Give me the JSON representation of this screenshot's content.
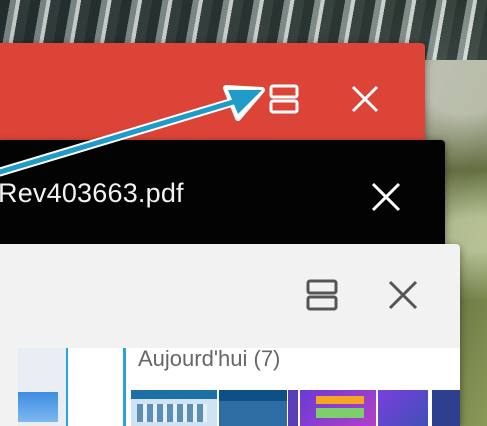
{
  "recents": {
    "cards": [
      {
        "id": "red",
        "color": "#dc4437",
        "icons": [
          "split-screen-icon",
          "close-icon"
        ]
      },
      {
        "id": "black",
        "color": "#030303",
        "title": "Rev403663.pdf",
        "icons": [
          "close-icon"
        ]
      },
      {
        "id": "white",
        "color": "#f2f2f2",
        "icons": [
          "split-screen-icon",
          "close-icon"
        ],
        "preview": {
          "section_title": "Aujourd'hui (7)"
        }
      }
    ]
  },
  "annotation": {
    "arrow_color": "#1e9bc8",
    "points_to": "split-screen-icon"
  }
}
